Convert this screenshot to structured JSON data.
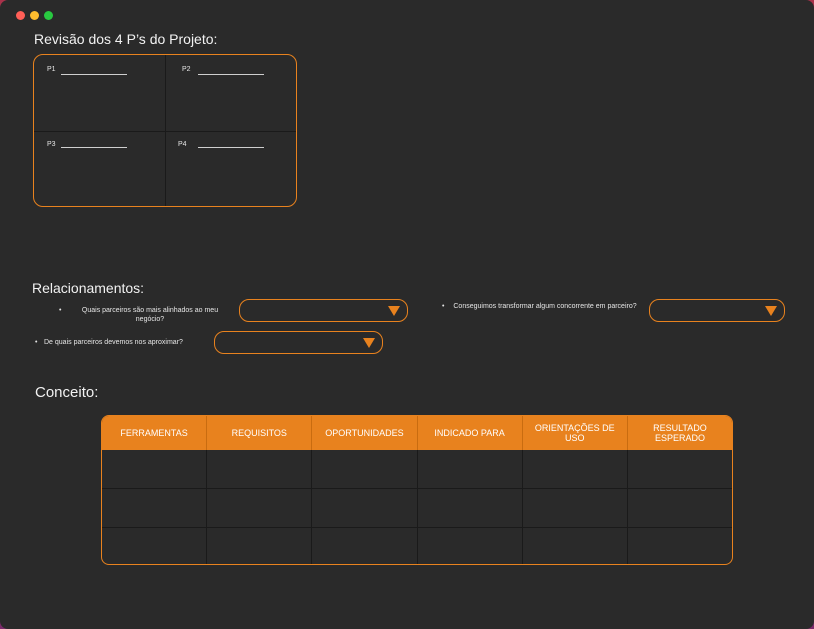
{
  "section1": {
    "title": "Revisão dos 4 P’s do Projeto:",
    "cells": [
      {
        "label": "P1"
      },
      {
        "label": "P2"
      },
      {
        "label": "P3"
      },
      {
        "label": "P4"
      }
    ]
  },
  "section2": {
    "title": "Relacionamentos:",
    "questions": [
      {
        "text": "Quais parceiros são mais alinhados ao meu negócio?"
      },
      {
        "text": "De quais parceiros  devemos nos aproximar?"
      },
      {
        "text": "Conseguimos transformar algum concorrente em parceiro?"
      }
    ]
  },
  "section3": {
    "title": "Conceito:",
    "columns": [
      "FERRAMENTAS",
      "REQUISITOS",
      "OPORTUNIDADES",
      "INDICADO PARA",
      "ORIENTAÇÕES DE USO",
      "RESULTADO ESPERADO"
    ]
  },
  "colors": {
    "accent": "#e8821e",
    "background": "#2a2a2a"
  }
}
